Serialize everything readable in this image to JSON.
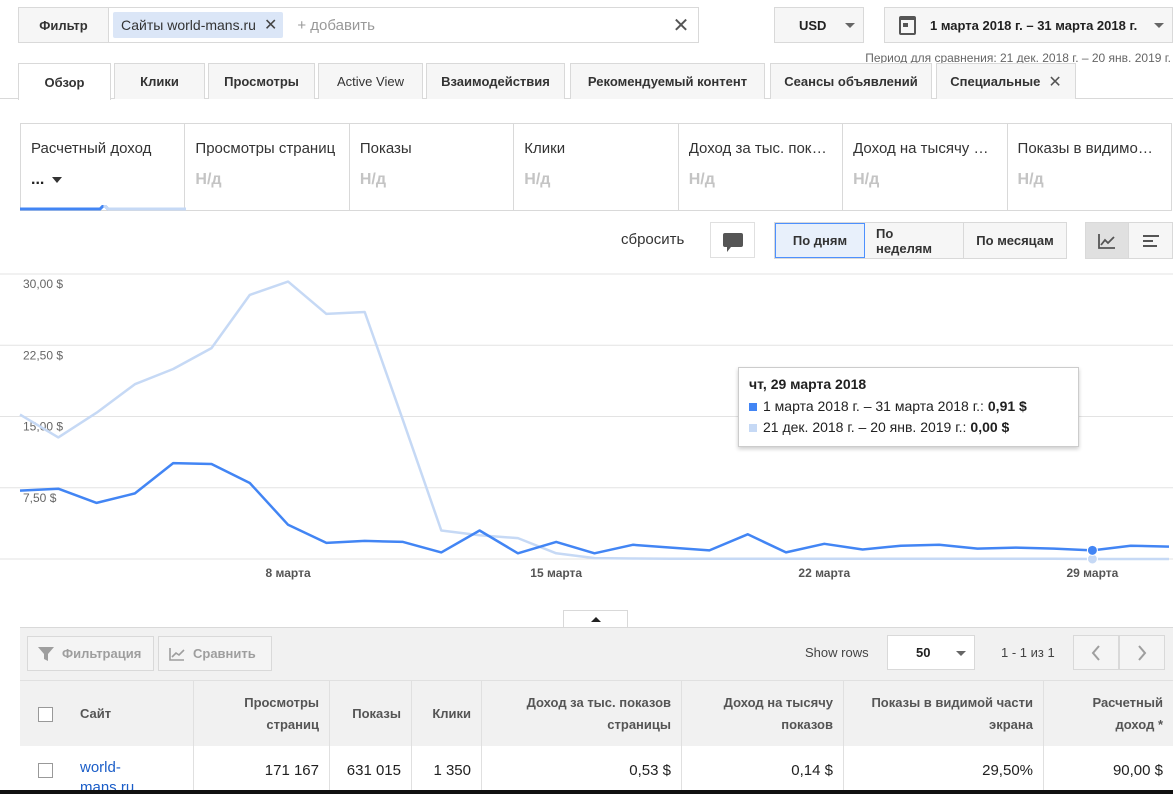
{
  "filter": {
    "label": "Фильтр",
    "chip": "Сайты world-mans.ru",
    "chip_close": "✕",
    "add_placeholder": "+ добавить",
    "clear": "✕"
  },
  "currency": "USD",
  "date_range": "1 марта 2018 г. – 31 марта 2018 г.",
  "compare_period": "Период для сравнения: 21 дек. 2018 г. – 20 янв. 2019 г.",
  "tabs": [
    {
      "label": "Обзор"
    },
    {
      "label": "Клики"
    },
    {
      "label": "Просмотры"
    },
    {
      "label": "Active View"
    },
    {
      "label": "Взаимодействия"
    },
    {
      "label": "Рекомендуемый контент"
    },
    {
      "label": "Сеансы объявлений"
    },
    {
      "label": "Специальные",
      "close": "✕"
    }
  ],
  "metrics": [
    {
      "title": "Расчетный доход",
      "value": "..."
    },
    {
      "title": "Просмотры страниц",
      "value": "Н/д"
    },
    {
      "title": "Показы",
      "value": "Н/д"
    },
    {
      "title": "Клики",
      "value": "Н/д"
    },
    {
      "title": "Доход за тыс. показов страницы",
      "value": "Н/д"
    },
    {
      "title": "Доход на тысячу показов",
      "value": "Н/д"
    },
    {
      "title": "Показы в видимой части экрана",
      "value": "Н/д"
    }
  ],
  "controls": {
    "reset": "сбросить",
    "periods": [
      "По дням",
      "По неделям",
      "По месяцам"
    ]
  },
  "colors": {
    "primary": "#4285f4",
    "compare": "#c6d9f5",
    "grid": "#e3e3e3"
  },
  "chart_data": {
    "type": "line",
    "x": [
      1,
      2,
      3,
      4,
      5,
      6,
      7,
      8,
      9,
      10,
      11,
      12,
      13,
      14,
      15,
      16,
      17,
      18,
      19,
      20,
      21,
      22,
      23,
      24,
      25,
      26,
      27,
      28,
      29,
      30,
      31
    ],
    "x_ticks": [
      {
        "x": 8,
        "label": "8 марта"
      },
      {
        "x": 15,
        "label": "15 марта"
      },
      {
        "x": 22,
        "label": "22 марта"
      },
      {
        "x": 29,
        "label": "29 марта"
      }
    ],
    "y_ticks": [
      {
        "v": 7.5,
        "label": "7,50 $"
      },
      {
        "v": 15,
        "label": "15,00 $"
      },
      {
        "v": 22.5,
        "label": "22,50 $"
      },
      {
        "v": 30,
        "label": "30,00 $"
      }
    ],
    "ylim": [
      0,
      30
    ],
    "series": [
      {
        "name": "1 марта 2018 г. – 31 марта 2018 г.",
        "values": [
          7.2,
          7.4,
          5.9,
          6.9,
          10.1,
          10.0,
          8.0,
          3.6,
          1.7,
          1.9,
          1.8,
          0.7,
          3.0,
          0.6,
          1.8,
          0.6,
          1.5,
          1.2,
          0.9,
          2.6,
          0.7,
          1.6,
          1.0,
          1.4,
          1.5,
          1.1,
          1.2,
          1.1,
          0.91,
          1.4,
          1.3
        ]
      },
      {
        "name": "21 дек. 2018 г. – 20 янв. 2019 г.",
        "values": [
          15.2,
          12.8,
          15.4,
          18.4,
          20.0,
          22.2,
          27.8,
          29.2,
          25.8,
          26.0,
          14.6,
          3.0,
          2.5,
          2.2,
          0.6,
          0.1,
          0.05,
          0.03,
          0.02,
          0.02,
          0.02,
          0.02,
          0.02,
          0.02,
          0.02,
          0.02,
          0.02,
          0.02,
          0.0,
          0.0,
          0.0
        ]
      }
    ]
  },
  "tooltip": {
    "title": "чт, 29 марта 2018",
    "rows": [
      {
        "label": "1 марта 2018 г. – 31 марта 2018 г.:",
        "value": "0,91 $"
      },
      {
        "label": "21 дек. 2018 г. – 20 янв. 2019 г.:",
        "value": "0,00 $"
      }
    ]
  },
  "table": {
    "filter_btn": "Фильтрация",
    "compare_btn": "Сравнить",
    "show_rows": "Show rows",
    "rows_value": "50",
    "pager": "1 - 1 из 1",
    "headers": {
      "site": "Сайт",
      "pageviews": "Просмотры страниц",
      "impressions": "Показы",
      "clicks": "Клики",
      "page_rpm": "Доход за тыс. показов страницы",
      "imp_rpm": "Доход на тысячу показов",
      "viewable": "Показы в видимой части экрана",
      "revenue": "Расчетный доход *"
    },
    "rows": [
      {
        "site": "world-mans.ru",
        "pageviews": "171 167",
        "impressions": "631 015",
        "clicks": "1 350",
        "page_rpm": "0,53 $",
        "imp_rpm": "0,14 $",
        "viewable": "29,50%",
        "revenue": "90,00 $"
      }
    ]
  }
}
